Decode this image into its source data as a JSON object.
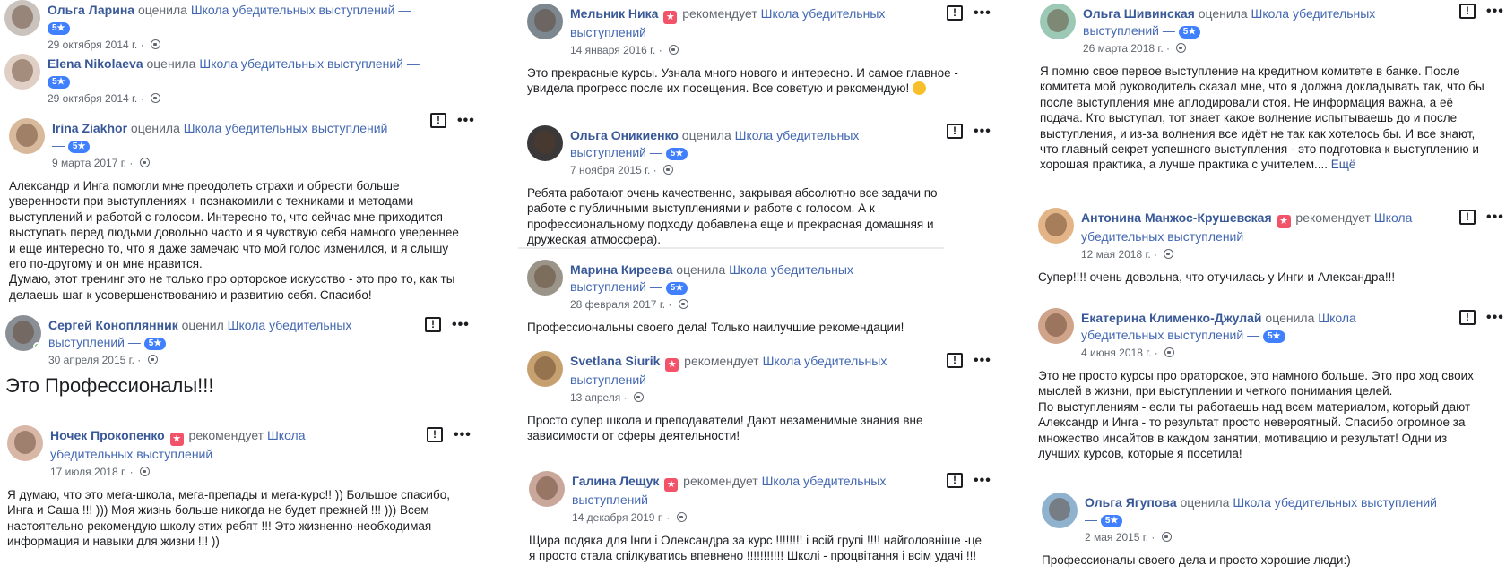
{
  "page_name": "Школа убедительных выступлений",
  "dash": "—",
  "more_link": "Ещё",
  "verbs": {
    "rated_f": "оценила",
    "rated_m": "оценил",
    "recommends": "рекомендует"
  },
  "badge_5": "5★",
  "reviews": {
    "r1": {
      "author": "Ольга Ларина",
      "date": "29 октября 2014 г."
    },
    "r2": {
      "author": "Elena Nikolaeva",
      "date": "29 октября 2014 г."
    },
    "r3": {
      "author": "Irina Ziakhor",
      "date": "9 марта 2017 г.",
      "text": "Александр и Инга помогли мне преодолеть страхи и обрести больше уверенности при выступлениях + познакомили с техниками и методами выступлений и работой с голосом. Интересно то, что сейчас мне приходится выступать перед людьми довольно часто и я чувствую себя намного увереннее и еще интересно то, что я даже замечаю что мой голос изменился, и я слышу его по-другому и он мне нравится.",
      "text2": "Думаю, этот тренинг это не только про орторское искусство - это про то, как ты делаешь шаг к усовершенствованию и развитию себя. Спасибо!"
    },
    "r4": {
      "author": "Сергей Коноплянник",
      "date": "30 апреля 2015 г.",
      "text": "Это Профессионалы!!!"
    },
    "r5": {
      "author": "Ночек Прокопенко",
      "date": "17 июля 2018 г.",
      "text": "Я думаю, что это мега-школа, мега-препады и мега-курс!! )) Большое спасибо, Инга и Саша !!! ))) Моя жизнь больше никогда не будет прежней !!! ))) Всем настоятельно рекомендую школу этих ребят !!! Это жизненно-необходимая информация и навыки для жизни !!! ))"
    },
    "r6": {
      "author": "Мельник Ника",
      "date": "14 января 2016 г.",
      "text": "Это прекрасные курсы. Узнала много нового и интересно. И самое главное - увидела прогресс после их посещения. Все советую и рекомендую!"
    },
    "r7": {
      "author": "Ольга Оникиенко",
      "date": "7 ноября 2015 г.",
      "text": "Ребята работают очень качественно, закрывая абсолютно все задачи по работе с публичными выступлениями и работе с голосом. А к профессиональному подходу добавлена еще и прекрасная домашняя и дружеская атмосфера)."
    },
    "r8": {
      "author": "Марина Киреева",
      "date": "28 февраля 2017 г.",
      "text": "Профессиональны своего дела! Только наилучшие рекомендации!"
    },
    "r9": {
      "author": "Svetlana Siurik",
      "date": "13 апреля",
      "text": "Просто супер школа и преподаватели! Дают незаменимые знания вне зависимости от сферы деятельности!"
    },
    "r10": {
      "author": "Галина Лещук",
      "date": "14 декабря 2019 г.",
      "text": "Щира подяка для Інги і Олександра за курс !!!!!!!! і всій групі !!!! найголовніше -це я просто стала спілкуватись впевнено !!!!!!!!!!! Школі - процвітання і всім удачі !!!"
    },
    "r11": {
      "author": "Ольга Шивинская",
      "date": "26 марта 2018 г.",
      "text": "Я помню свое первое выступление на кредитном комитете в банке. После комитета мой руководитель сказал мне, что я должна докладывать так, что бы после выступления мне аплодировали стоя. Не информация важна, а её подача. Кто выступал, тот знает какое волнение испытываешь до и после выступления, и из-за волнения все идёт не так как хотелось бы. И все знают, что главный секрет успешного выступления - это подготовка к выступлению и хорошая практика, а лучше практика с учителем...."
    },
    "r12": {
      "author": "Антонина Манжос-Крушевская",
      "date": "12 мая 2018 г.",
      "text": "Супер!!!! очень довольна, что отучилась у Инги и Александра!!!"
    },
    "r13": {
      "author": "Екатерина Клименко-Джулай",
      "date": "4 июня 2018 г.",
      "text": "Это не просто курсы про ораторское, это намного больше. Это про ход своих мыслей в жизни, при выступлении и четкого понимания целей.",
      "text2": "По выступлениям - если ты работаешь над всем материалом, который дают Александр и Инга - то результат просто невероятный. Спасибо огромное за множество инсайтов в каждом занятии, мотивацию и результат! Одни из лучших курсов, которые я посетила!"
    },
    "r14": {
      "author": "Ольга Ягупова",
      "date": "2 мая 2015 г.",
      "text": "Профессионалы своего дела и просто хорошие люди:)"
    }
  },
  "colors": {
    "link": "#385898",
    "page_link": "#4267b2",
    "badge": "#4080ff",
    "recommend": "#f35369",
    "meta": "#616770"
  }
}
